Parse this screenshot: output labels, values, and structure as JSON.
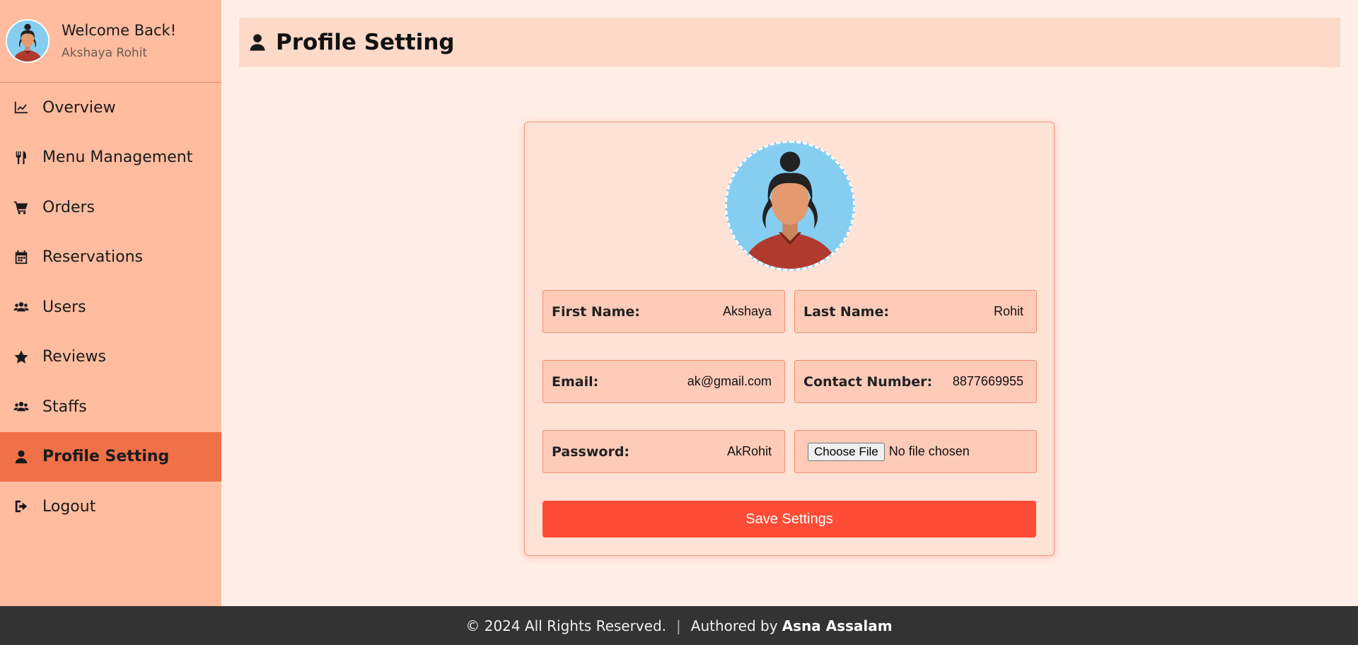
{
  "sidebar": {
    "welcome": "Welcome Back!",
    "user_name": "Akshaya Rohit",
    "items": [
      {
        "label": "Overview",
        "icon": "chart-line-icon"
      },
      {
        "label": "Menu Management",
        "icon": "utensils-icon"
      },
      {
        "label": "Orders",
        "icon": "cart-icon"
      },
      {
        "label": "Reservations",
        "icon": "calendar-icon"
      },
      {
        "label": "Users",
        "icon": "users-icon"
      },
      {
        "label": "Reviews",
        "icon": "star-icon"
      },
      {
        "label": "Staffs",
        "icon": "users-icon"
      },
      {
        "label": "Profile Setting",
        "icon": "user-icon",
        "active": true
      },
      {
        "label": "Logout",
        "icon": "sign-out-icon"
      }
    ]
  },
  "header": {
    "title": "Profile Setting"
  },
  "form": {
    "first_name_label": "First Name:",
    "first_name": "Akshaya",
    "last_name_label": "Last Name:",
    "last_name": "Rohit",
    "email_label": "Email:",
    "email": "ak@gmail.com",
    "contact_label": "Contact Number:",
    "contact": "8877669955",
    "password_label": "Password:",
    "password": "AkRohit",
    "file_button": "Choose File",
    "file_status": "No file chosen",
    "save_label": "Save Settings"
  },
  "footer": {
    "copyright": "© 2024 All Rights Reserved.",
    "separator": "|",
    "authored_by": "Authored by",
    "author": "Asna Assalam"
  },
  "colors": {
    "sidebar_bg": "#ffbc9f",
    "active_item": "#f07048",
    "header_bg": "#fddac8",
    "page_bg": "#ffeee6",
    "card_bg": "#ffe2d6",
    "field_bg": "#fecbb8",
    "save_button": "#ff4c36",
    "footer_bg": "#333333"
  }
}
